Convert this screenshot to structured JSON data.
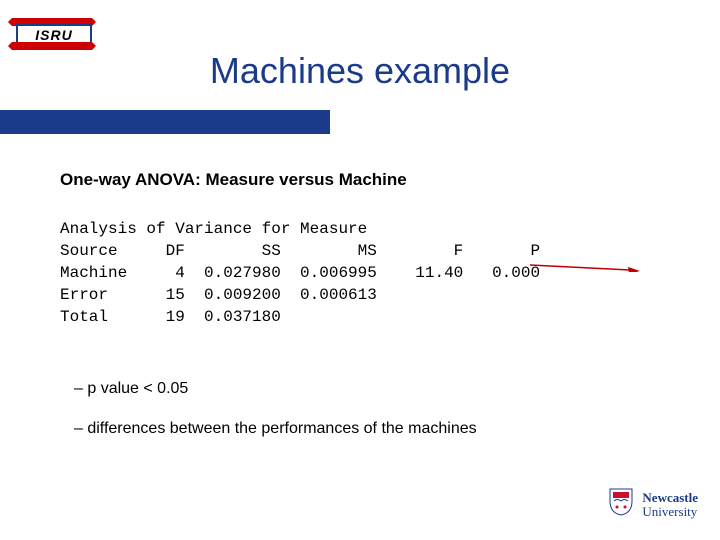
{
  "logo": {
    "text": "ISRU"
  },
  "title": "Machines example",
  "subtitle": "One-way ANOVA: Measure versus Machine",
  "anova": {
    "header": "Analysis of Variance for Measure",
    "columns": "Source     DF        SS        MS        F       P",
    "rows": [
      "Machine     4  0.027980  0.006995    11.40   0.000",
      "Error      15  0.009200  0.000613",
      "Total      19  0.037180"
    ]
  },
  "bullets": {
    "b1": "– p value < 0.05",
    "b2": "– differences between the performances of the machines"
  },
  "university": {
    "line1": "Newcastle",
    "line2": "University"
  }
}
